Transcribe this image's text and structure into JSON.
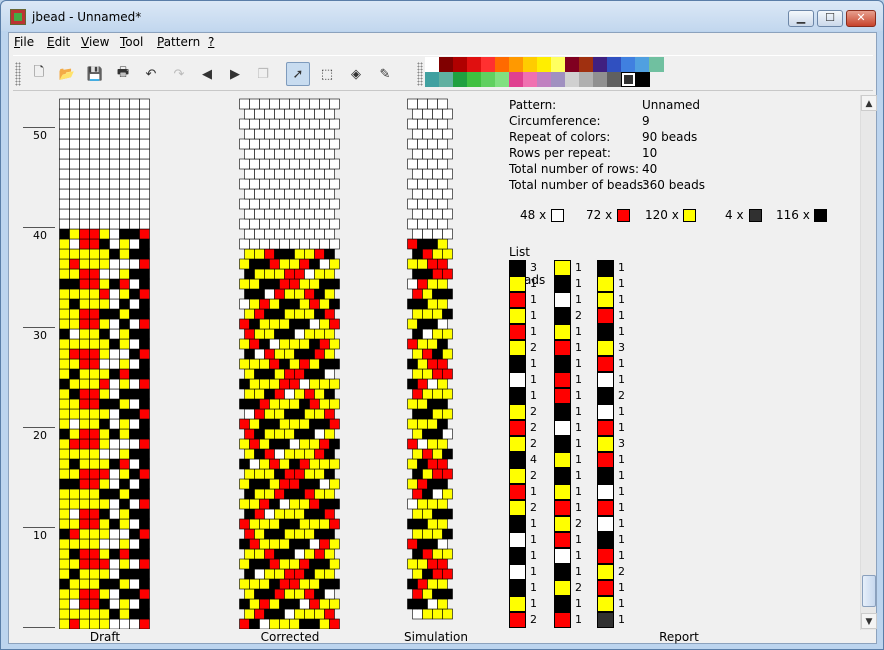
{
  "window": {
    "title": "jbead - Unnamed*"
  },
  "window_buttons": {
    "minimize": "▁",
    "maximize": "☐",
    "close": "✕"
  },
  "menu": [
    {
      "label": "File",
      "accel": "F",
      "rest": "ile"
    },
    {
      "label": "Edit",
      "accel": "E",
      "rest": "dit"
    },
    {
      "label": "View",
      "accel": "V",
      "rest": "iew"
    },
    {
      "label": "Tool",
      "accel": "T",
      "rest": "ool"
    },
    {
      "label": "Pattern",
      "accel": "P",
      "rest": "attern"
    },
    {
      "label": "?",
      "accel": "?",
      "rest": ""
    }
  ],
  "toolbar": {
    "buttons": [
      {
        "name": "new-file-icon",
        "glyph": "🗋",
        "active": false,
        "disabled": false
      },
      {
        "name": "open-folder-icon",
        "glyph": "📂",
        "active": false,
        "disabled": false
      },
      {
        "name": "save-icon",
        "glyph": "💾",
        "active": false,
        "disabled": false
      },
      {
        "name": "print-icon",
        "glyph": "🖶",
        "active": false,
        "disabled": false
      },
      {
        "name": "undo-icon",
        "glyph": "↶",
        "active": false,
        "disabled": false
      },
      {
        "name": "redo-icon",
        "glyph": "↷",
        "active": false,
        "disabled": true
      },
      {
        "name": "arrow-left-icon",
        "glyph": "◀",
        "active": false,
        "disabled": false
      },
      {
        "name": "arrow-right-icon",
        "glyph": "▶",
        "active": false,
        "disabled": false
      },
      {
        "name": "copy-pattern-icon",
        "glyph": "❐",
        "active": false,
        "disabled": true
      },
      {
        "name": "pointer-tool-icon",
        "glyph": "➚",
        "active": true,
        "disabled": false
      },
      {
        "name": "select-rect-icon",
        "glyph": "⬚",
        "active": false,
        "disabled": false
      },
      {
        "name": "fill-bucket-icon",
        "glyph": "◈",
        "active": false,
        "disabled": false
      },
      {
        "name": "color-picker-icon",
        "glyph": "✎",
        "active": false,
        "disabled": false
      }
    ]
  },
  "palette": {
    "row1": [
      "#ffffff",
      "#800000",
      "#b00000",
      "#e01010",
      "#ff3030",
      "#ff6a00",
      "#ff9900",
      "#ffcc00",
      "#ffee00",
      "#ffff60",
      "#800020",
      "#a03010",
      "#402080",
      "#3050c0",
      "#4080e0",
      "#50a0e0",
      "#70c0a0"
    ],
    "row2": [
      "#40a0a0",
      "#60b0a0",
      "#20a040",
      "#40c040",
      "#60d060",
      "#80e080",
      "#e04090",
      "#f070b0",
      "#c080c0",
      "#a090c0",
      "#d0d0d0",
      "#b0b0b0",
      "#909090",
      "#606060",
      "#303030",
      "#000000"
    ],
    "selected_index_row2": 14
  },
  "colors": {
    "white": "#ffffff",
    "red": "#ff0000",
    "yellow": "#ffff00",
    "black": "#000000",
    "dark": "#303030"
  },
  "ruler": {
    "labels": [
      "50",
      "40",
      "30",
      "20",
      "10"
    ]
  },
  "panels": {
    "draft": "Draft",
    "corrected": "Corrected",
    "simulation": "Simulation",
    "report": "Report"
  },
  "report": {
    "rows": [
      {
        "label": "Pattern:",
        "value": "Unnamed"
      },
      {
        "label": "Circumference:",
        "value": "9"
      },
      {
        "label": "Repeat of colors:",
        "value": "90 beads"
      },
      {
        "label": "Rows per repeat:",
        "value": "10"
      },
      {
        "label": "Total number of rows:",
        "value": "40"
      },
      {
        "label": "Total number of beads:",
        "value": "360 beads"
      }
    ],
    "counts": [
      {
        "text": "48 x",
        "color": "#ffffff"
      },
      {
        "text": "72 x",
        "color": "#ff0000"
      },
      {
        "text": "120 x",
        "color": "#ffff00"
      },
      {
        "text": "4 x",
        "color": "#303030"
      },
      {
        "text": "116 x",
        "color": "#000000"
      }
    ],
    "bead_list_title": "List of beads",
    "bead_list": [
      [
        {
          "c": "K",
          "n": "3"
        },
        {
          "c": "Y",
          "n": "1"
        },
        {
          "c": "R",
          "n": "1"
        },
        {
          "c": "Y",
          "n": "1"
        },
        {
          "c": "R",
          "n": "1"
        },
        {
          "c": "Y",
          "n": "2"
        },
        {
          "c": "K",
          "n": "1"
        },
        {
          "c": "W",
          "n": "1"
        },
        {
          "c": "K",
          "n": "1"
        },
        {
          "c": "Y",
          "n": "2"
        },
        {
          "c": "R",
          "n": "2"
        },
        {
          "c": "Y",
          "n": "2"
        },
        {
          "c": "K",
          "n": "4"
        },
        {
          "c": "Y",
          "n": "2"
        },
        {
          "c": "R",
          "n": "1"
        },
        {
          "c": "Y",
          "n": "2"
        },
        {
          "c": "K",
          "n": "1"
        },
        {
          "c": "W",
          "n": "1"
        },
        {
          "c": "K",
          "n": "1"
        },
        {
          "c": "W",
          "n": "1"
        },
        {
          "c": "K",
          "n": "1"
        },
        {
          "c": "Y",
          "n": "1"
        },
        {
          "c": "R",
          "n": "2"
        }
      ],
      [
        {
          "c": "Y",
          "n": "1"
        },
        {
          "c": "K",
          "n": "1"
        },
        {
          "c": "W",
          "n": "1"
        },
        {
          "c": "K",
          "n": "2"
        },
        {
          "c": "Y",
          "n": "1"
        },
        {
          "c": "R",
          "n": "1"
        },
        {
          "c": "K",
          "n": "1"
        },
        {
          "c": "R",
          "n": "1"
        },
        {
          "c": "R",
          "n": "1"
        },
        {
          "c": "K",
          "n": "1"
        },
        {
          "c": "W",
          "n": "1"
        },
        {
          "c": "K",
          "n": "1"
        },
        {
          "c": "Y",
          "n": "1"
        },
        {
          "c": "K",
          "n": "1"
        },
        {
          "c": "Y",
          "n": "1"
        },
        {
          "c": "R",
          "n": "1"
        },
        {
          "c": "Y",
          "n": "2"
        },
        {
          "c": "R",
          "n": "1"
        },
        {
          "c": "W",
          "n": "1"
        },
        {
          "c": "K",
          "n": "1"
        },
        {
          "c": "Y",
          "n": "2"
        },
        {
          "c": "K",
          "n": "1"
        },
        {
          "c": "R",
          "n": "1"
        }
      ],
      [
        {
          "c": "K",
          "n": "1"
        },
        {
          "c": "Y",
          "n": "1"
        },
        {
          "c": "Y",
          "n": "1"
        },
        {
          "c": "R",
          "n": "1"
        },
        {
          "c": "K",
          "n": "1"
        },
        {
          "c": "Y",
          "n": "3"
        },
        {
          "c": "R",
          "n": "1"
        },
        {
          "c": "W",
          "n": "1"
        },
        {
          "c": "K",
          "n": "2"
        },
        {
          "c": "W",
          "n": "1"
        },
        {
          "c": "R",
          "n": "1"
        },
        {
          "c": "Y",
          "n": "3"
        },
        {
          "c": "R",
          "n": "1"
        },
        {
          "c": "K",
          "n": "1"
        },
        {
          "c": "W",
          "n": "1"
        },
        {
          "c": "R",
          "n": "1"
        },
        {
          "c": "W",
          "n": "1"
        },
        {
          "c": "K",
          "n": "1"
        },
        {
          "c": "R",
          "n": "1"
        },
        {
          "c": "Y",
          "n": "2"
        },
        {
          "c": "R",
          "n": "1"
        },
        {
          "c": "Y",
          "n": "1"
        },
        {
          "c": "D",
          "n": "1"
        }
      ]
    ]
  }
}
